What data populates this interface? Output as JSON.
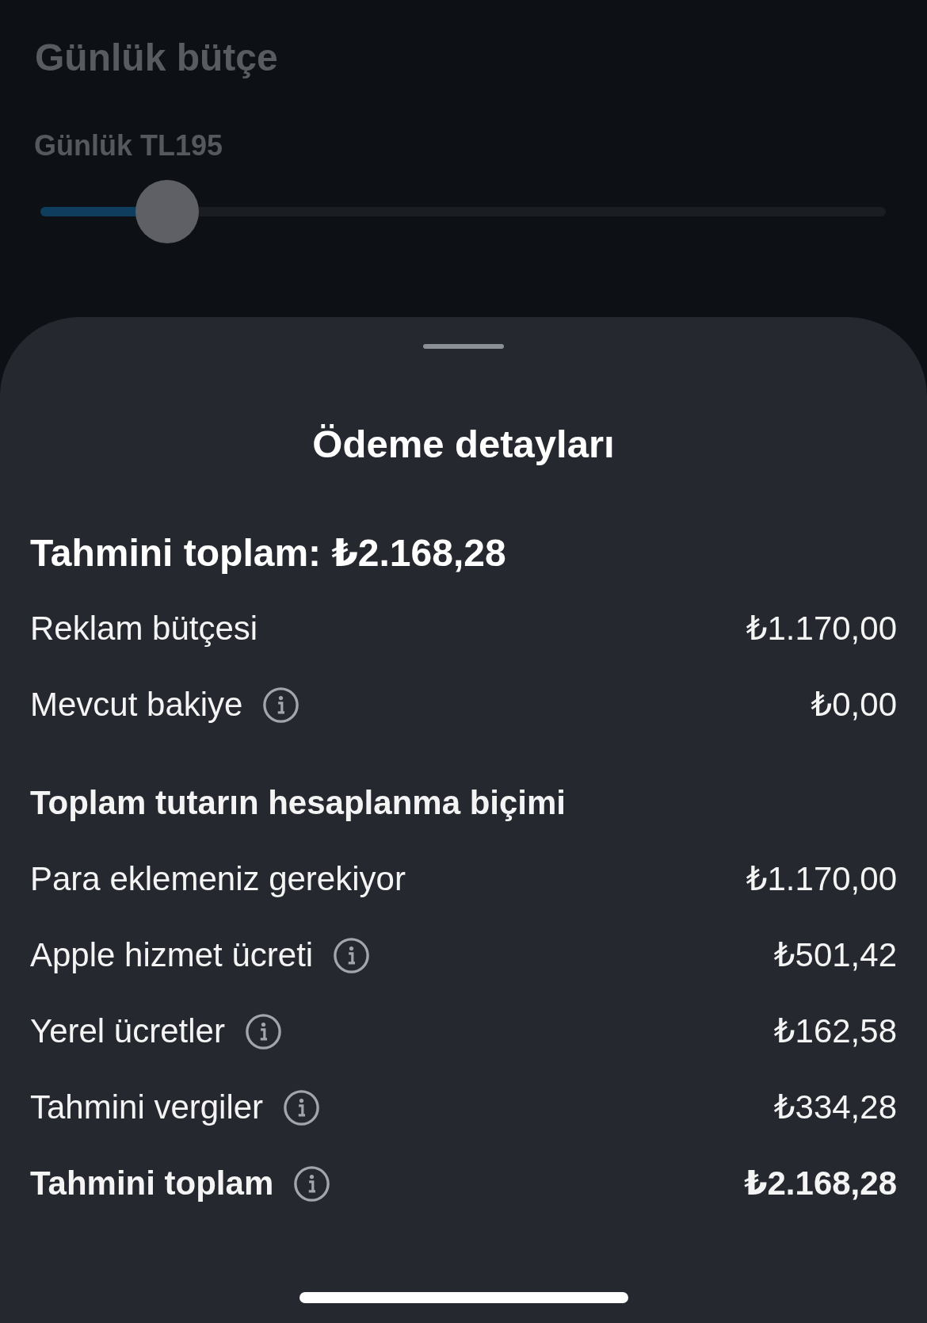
{
  "budget_screen": {
    "title": "Günlük bütçe",
    "slider": {
      "label": "Günlük TL195",
      "level": 0.15
    }
  },
  "payment_sheet": {
    "title": "Ödeme detayları",
    "summary": "Tahmini toplam: ₺2.168,28",
    "rows": [
      {
        "kind": "item",
        "label": "Reklam bütçesi",
        "info": false,
        "amount": "₺1.170,00"
      },
      {
        "kind": "item",
        "label": "Mevcut bakiye",
        "info": true,
        "amount": "₺0,00"
      }
    ],
    "breakdown": {
      "heading": "Toplam tutarın hesaplanma biçimi",
      "rows": [
        {
          "kind": "item",
          "label": "Para eklemeniz gerekiyor",
          "info": false,
          "amount": "₺1.170,00"
        },
        {
          "kind": "item",
          "label": "Apple hizmet ücreti",
          "info": true,
          "amount": "₺501,42"
        },
        {
          "kind": "item",
          "label": "Yerel ücretler",
          "info": true,
          "amount": "₺162,58"
        },
        {
          "kind": "item",
          "label": "Tahmini vergiler",
          "info": true,
          "amount": "₺334,28"
        },
        {
          "kind": "total",
          "label": "Tahmini toplam",
          "info": true,
          "amount": "₺2.168,28"
        }
      ]
    }
  }
}
